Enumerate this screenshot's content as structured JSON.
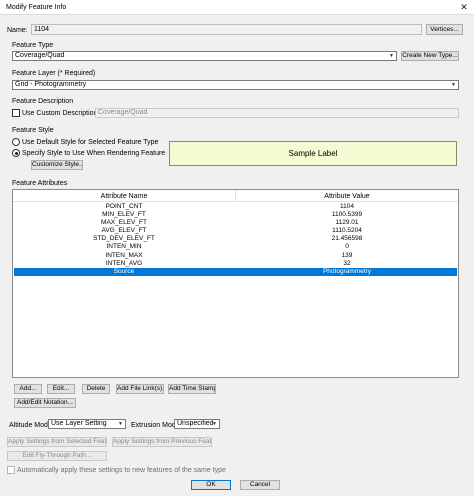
{
  "window": {
    "title": "Modify Feature Info",
    "close_glyph": "✕"
  },
  "name": {
    "label": "Name:",
    "value": "1104",
    "vertices_button": "Vertices..."
  },
  "feature_type": {
    "label": "Feature Type",
    "value": "Coverage/Quad",
    "new_type_button": "Create New Type..."
  },
  "feature_layer": {
    "label": "Feature Layer (* Required)",
    "value": "Grid - Photogrammetry"
  },
  "feature_description": {
    "label": "Feature Description",
    "custom_checkbox_label": "Use Custom Description:",
    "custom_value": "Coverage/Quad",
    "custom_checked": false
  },
  "feature_style": {
    "label": "Feature Style",
    "radio_default": "Use Default Style for Selected Feature Type",
    "radio_specify": "Specify Style to Use When Rendering Feature",
    "selected": "specify",
    "customize_button": "Customize Style...",
    "sample_label": "Sample Label",
    "sample_color": "#f2fbd1"
  },
  "attributes": {
    "label": "Feature Attributes",
    "columns": [
      "Attribute Name",
      "Attribute Value"
    ],
    "rows": [
      {
        "name": "POINT_CNT",
        "value": "1104",
        "selected": false
      },
      {
        "name": "MIN_ELEV_FT",
        "value": "1100.5399",
        "selected": false
      },
      {
        "name": "MAX_ELEV_FT",
        "value": "1129.01",
        "selected": false
      },
      {
        "name": "AVG_ELEV_FT",
        "value": "1110.5204",
        "selected": false
      },
      {
        "name": "STD_DEV_ELEV_FT",
        "value": "21.456598",
        "selected": false
      },
      {
        "name": "INTEN_MIN",
        "value": "0",
        "selected": false
      },
      {
        "name": "INTEN_MAX",
        "value": "139",
        "selected": false
      },
      {
        "name": "INTEN_AVG",
        "value": "32",
        "selected": false
      },
      {
        "name": "Source",
        "value": "Photogrammetry",
        "selected": true
      }
    ],
    "selection_color": "#0078d7"
  },
  "attribute_buttons": {
    "add": "Add...",
    "edit": "Edit...",
    "delete": "Delete",
    "add_file_links": "Add File Link(s)...",
    "add_time_stamp": "Add Time Stamp",
    "add_edit_notation": "Add/Edit Notation..."
  },
  "modes": {
    "altitude_label": "Altitude Mode:",
    "altitude_value": "Use Layer Setting",
    "extrusion_label": "Extrusion Mode:",
    "extrusion_value": "Unspecified"
  },
  "apply_buttons": {
    "from_selected": "Apply Settings from Selected Feature",
    "from_previous": "Apply Settings from Previous Feature",
    "fly_through": "Edit Fly-Through Path..."
  },
  "auto_apply": {
    "label": "Automatically apply these settings to new features of the same type",
    "checked": false
  },
  "footer": {
    "ok": "OK",
    "cancel": "Cancel"
  }
}
